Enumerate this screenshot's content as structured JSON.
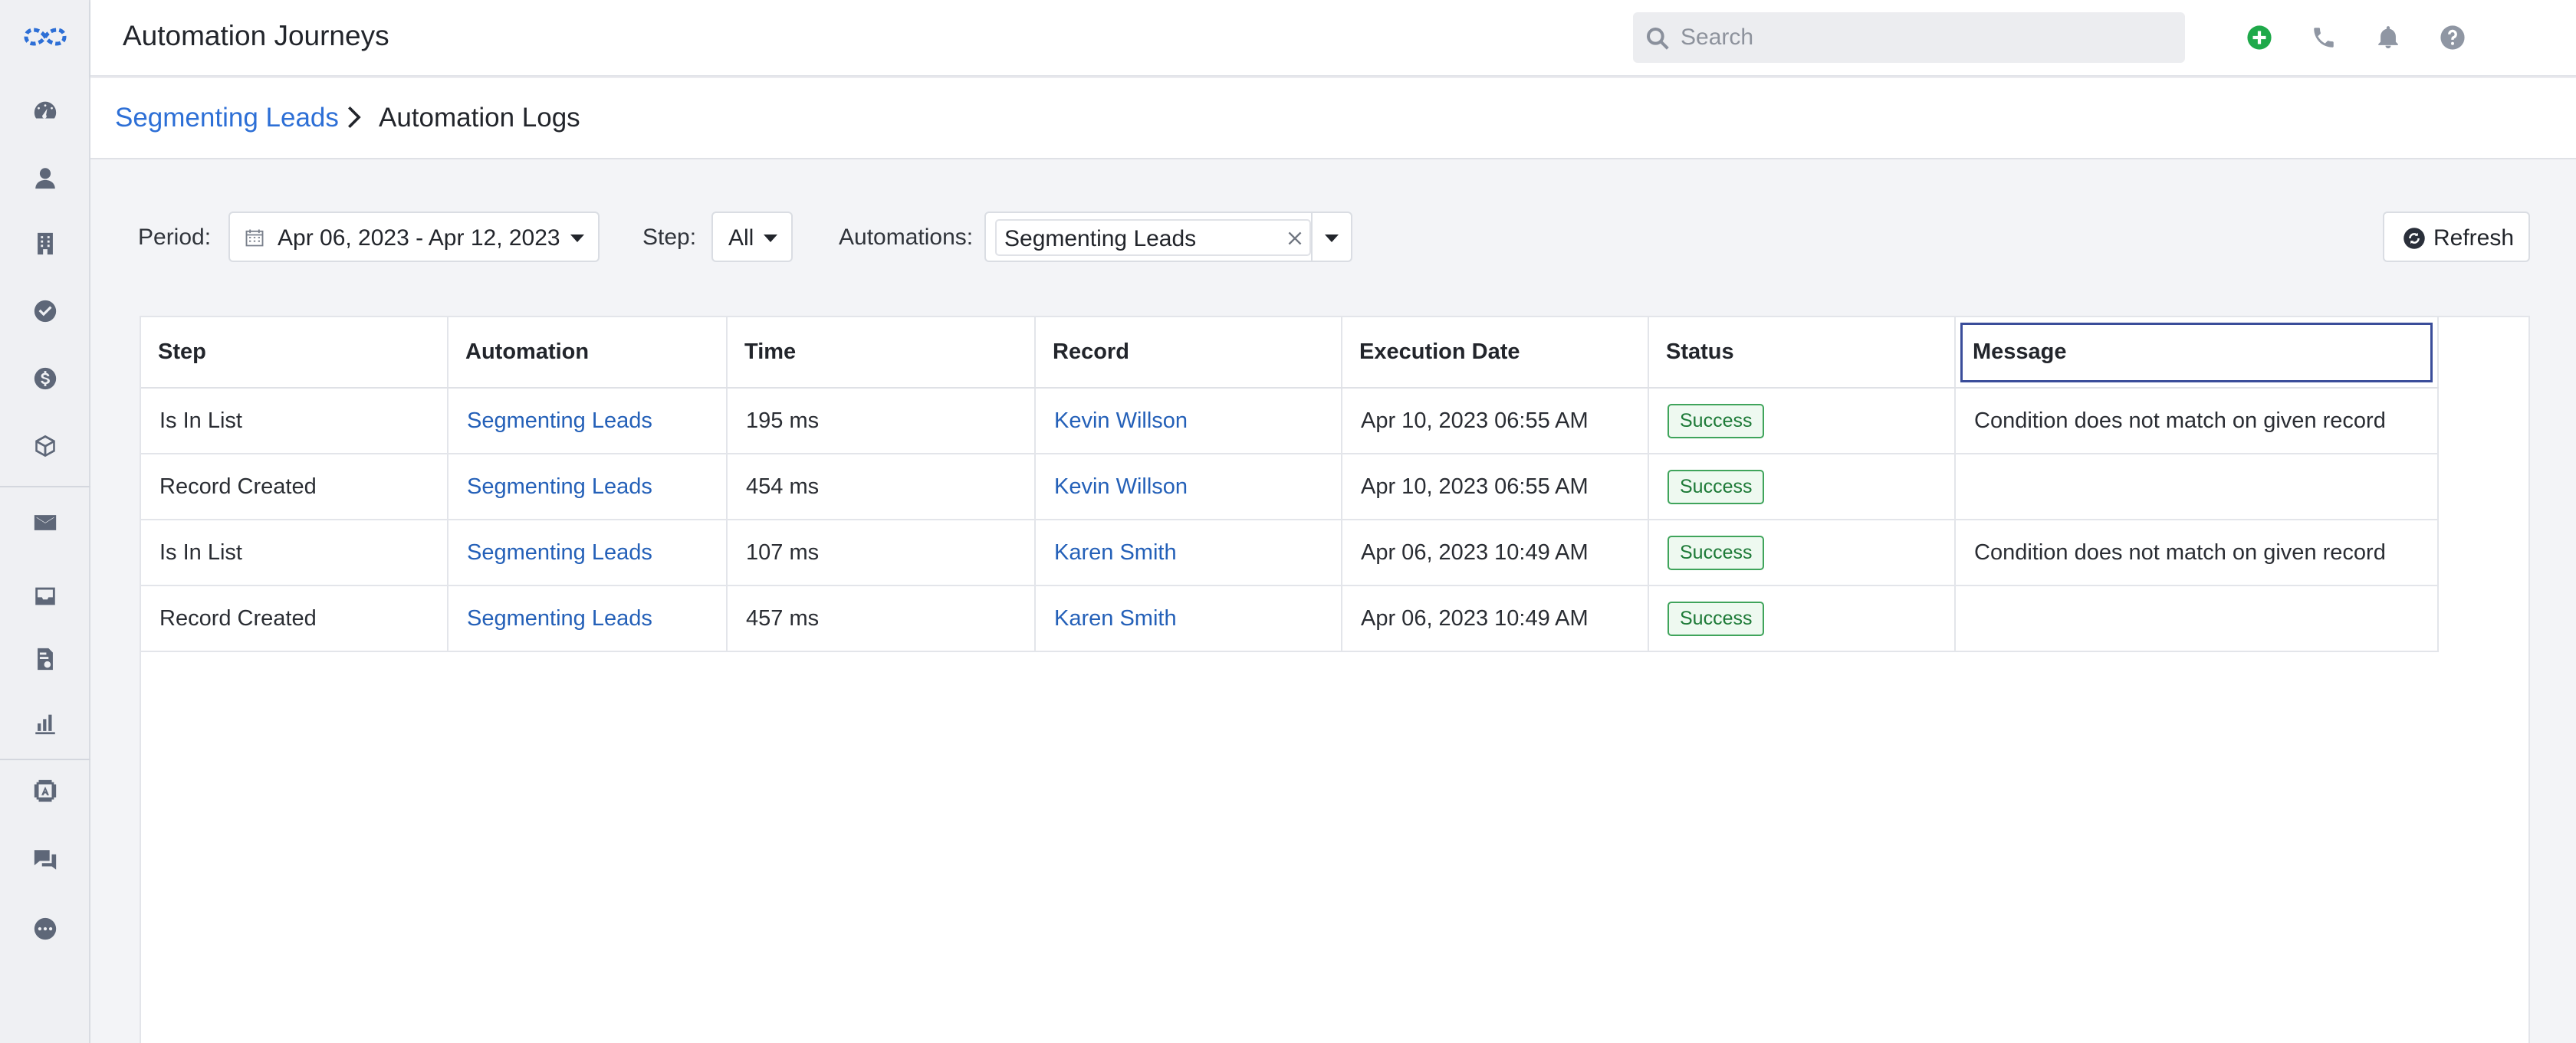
{
  "app": {
    "title": "Automation Journeys"
  },
  "search": {
    "placeholder": "Search"
  },
  "sidebar": {
    "items": [
      {
        "icon": "dashboard-icon"
      },
      {
        "icon": "contacts-icon"
      },
      {
        "icon": "companies-icon"
      },
      {
        "icon": "tasks-icon"
      },
      {
        "icon": "deals-icon"
      },
      {
        "icon": "products-icon"
      },
      {
        "icon": "email-icon"
      },
      {
        "icon": "inbox-icon"
      },
      {
        "icon": "documents-icon"
      },
      {
        "icon": "reports-icon"
      },
      {
        "icon": "automation-icon"
      },
      {
        "icon": "chat-icon"
      },
      {
        "icon": "more-icon"
      }
    ]
  },
  "breadcrumb": {
    "parent": "Segmenting Leads",
    "current": "Automation Logs"
  },
  "filters": {
    "period_label": "Period:",
    "period_value": "Apr 06, 2023 - Apr 12, 2023",
    "step_label": "Step:",
    "step_value": "All",
    "automations_label": "Automations:",
    "automations_chip": "Segmenting Leads",
    "refresh_label": "Refresh"
  },
  "table": {
    "headers": [
      "Step",
      "Automation",
      "Time",
      "Record",
      "Execution Date",
      "Status",
      "Message"
    ],
    "rows": [
      {
        "step": "Is In List",
        "automation": "Segmenting Leads",
        "time": "195 ms",
        "record": "Kevin Willson",
        "date": "Apr 10, 2023 06:55 AM",
        "status": "Success",
        "message": "Condition does not match on given record"
      },
      {
        "step": "Record Created",
        "automation": "Segmenting Leads",
        "time": "454 ms",
        "record": "Kevin Willson",
        "date": "Apr 10, 2023 06:55 AM",
        "status": "Success",
        "message": ""
      },
      {
        "step": "Is In List",
        "automation": "Segmenting Leads",
        "time": "107 ms",
        "record": "Karen Smith",
        "date": "Apr 06, 2023 10:49 AM",
        "status": "Success",
        "message": "Condition does not match on given record"
      },
      {
        "step": "Record Created",
        "automation": "Segmenting Leads",
        "time": "457 ms",
        "record": "Karen Smith",
        "date": "Apr 06, 2023 10:49 AM",
        "status": "Success",
        "message": ""
      }
    ]
  },
  "colors": {
    "link": "#2d6fd6",
    "success": "#1d7a37",
    "add": "#1fa94a"
  }
}
